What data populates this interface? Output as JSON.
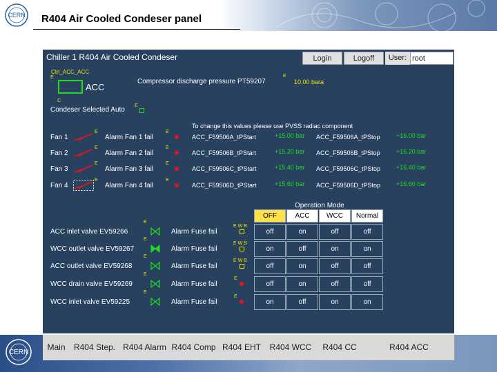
{
  "slide": {
    "title": "R404 Air Cooled Condeser panel"
  },
  "panel": {
    "title": "Chiller 1 R404 Air Cooled Condeser",
    "login_label": "Login",
    "logoff_label": "Logoff",
    "user_label": "User:",
    "user_value": "root",
    "ctrl_tag": "Ctrl_ACC_ACC",
    "acc_label": "ACC",
    "compressor_label": "Compressor discharge pressure PT59207",
    "compressor_value": "10.00 bara",
    "condeser_selected": "Condeser Selected Auto",
    "pvss_note": "To change this values please use PVSS radiac component",
    "marks": {
      "e": "E",
      "c": "C",
      "ewb": "E W B"
    },
    "fans": [
      {
        "label": "Fan 1",
        "alarm": "Alarm Fan 1 fail",
        "start_tag": "ACC_F59506A_tPStart",
        "start_val": "+15.00 bar",
        "stop_tag": "ACC_F59506A_tPStop",
        "stop_val": "+16.00 bar"
      },
      {
        "label": "Fan 2",
        "alarm": "Alarm Fan 2 fail",
        "start_tag": "ACC_F59506B_tPStart",
        "start_val": "+15.20 bar",
        "stop_tag": "ACC_F59506B_tPStop",
        "stop_val": "+16.20 bar"
      },
      {
        "label": "Fan 3",
        "alarm": "Alarm Fan 3 fail",
        "start_tag": "ACC_F59506C_tPStart",
        "start_val": "+15.40 bar",
        "stop_tag": "ACC_F59506C_tPStop",
        "stop_val": "+16.40 bar"
      },
      {
        "label": "Fan 4",
        "alarm": "Alarm Fan 4 fail",
        "start_tag": "ACC_F59506D_tPStart",
        "start_val": "+15.60 bar",
        "stop_tag": "ACC_F59506D_tPStop",
        "stop_val": "+16.60 bar"
      }
    ],
    "operation_mode": {
      "title": "Operation Mode",
      "columns": [
        "OFF",
        "ACC",
        "WCC",
        "Normal"
      ],
      "selected_column": "OFF"
    },
    "valves": [
      {
        "label": "ACC inlet valve EV59266",
        "alarm": "Alarm Fuse fail",
        "states": [
          "off",
          "on",
          "off",
          "off"
        ]
      },
      {
        "label": "WCC outlet valve EV59267",
        "alarm": "Alarm Fuse fail",
        "states": [
          "on",
          "off",
          "on",
          "on"
        ]
      },
      {
        "label": "ACC outlet valve EV59268",
        "alarm": "Alarm Fuse fail",
        "states": [
          "off",
          "on",
          "off",
          "off"
        ]
      },
      {
        "label": "WCC drain valve EV59269",
        "alarm": "Alarm Fuse fail",
        "states": [
          "off",
          "on",
          "off",
          "off"
        ]
      },
      {
        "label": "WCC inlet valve EV59225",
        "alarm": "Alarm Fuse fail",
        "states": [
          "on",
          "off",
          "on",
          "on"
        ]
      }
    ]
  },
  "nav": {
    "tabs": [
      "Main",
      "R404 Step.",
      "R404 Alarm",
      "R404 Comp",
      "R404 EHT",
      "R404 WCC",
      "R404 CC",
      "R404 ACC"
    ]
  },
  "colors": {
    "panel_bg": "#27415f",
    "value_yellow": "#e8e800",
    "value_green": "#1fdc1f",
    "alarm_red": "#e8121b",
    "mode_selected": "#ffe24a"
  }
}
